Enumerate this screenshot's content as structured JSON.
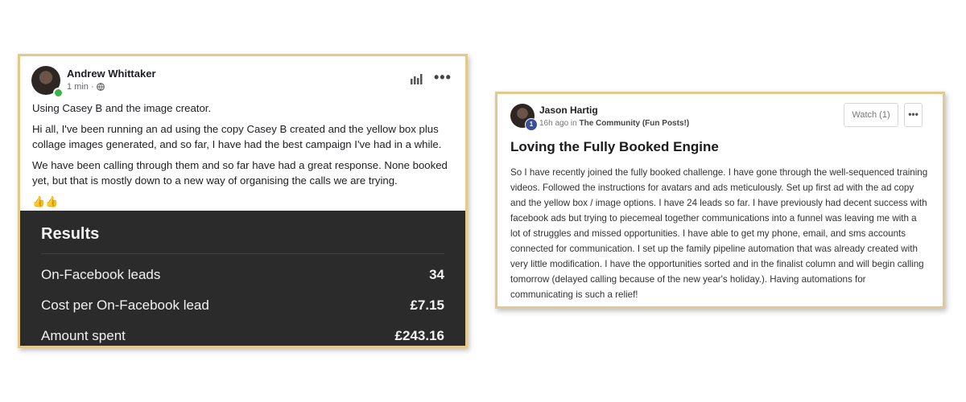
{
  "left_post": {
    "author": "Andrew Whittaker",
    "time": "1 min ·",
    "paragraphs": [
      "Using Casey B and the image creator.",
      "Hi all, I've been running an ad using the copy Casey B created and the yellow box plus collage images generated, and so far, I have had the best campaign I've had in a while.",
      "We have been calling through them and so far have had a great response. None booked yet, but that is mostly down to a new way of organising the calls we are trying."
    ],
    "emoji": "👍👍",
    "more_label": "•••",
    "results": {
      "title": "Results",
      "rows": [
        {
          "label": "On-Facebook leads",
          "value": "34"
        },
        {
          "label": "Cost per On-Facebook lead",
          "value": "£7.15"
        },
        {
          "label": "Amount spent",
          "value": "£243.16"
        }
      ]
    }
  },
  "right_post": {
    "author": "Jason Hartig",
    "level": "1",
    "time": "16h ago in",
    "community": "The Community (Fun Posts!)",
    "watch_label": "Watch (1)",
    "more_label": "•••",
    "title": "Loving the Fully Booked Engine",
    "body": "So I have recently joined the fully booked challenge. I have gone through the well-sequenced training videos. Followed the instructions for avatars and ads meticulously. Set up first ad with the ad copy and the yellow box / image options. I have 24 leads so far. I have previously had decent success with facebook ads but trying to piecemeal together communications into a funnel was leaving me with a lot of struggles and missed opportunities. I have able to get my phone, email, and sms accounts connected for communication. I set up the family pipeline automation that was already created with very little modification. I have the opportunities sorted and in the finalist column and will begin calling tomorrow (delayed calling because of the new year's holiday.). Having automations for communicating is such a relief!"
  },
  "colors": {
    "card_border": "#e3c98a",
    "results_bg": "#2b2b2b",
    "online": "#3bb34a",
    "level_badge": "#3c4f9b"
  }
}
